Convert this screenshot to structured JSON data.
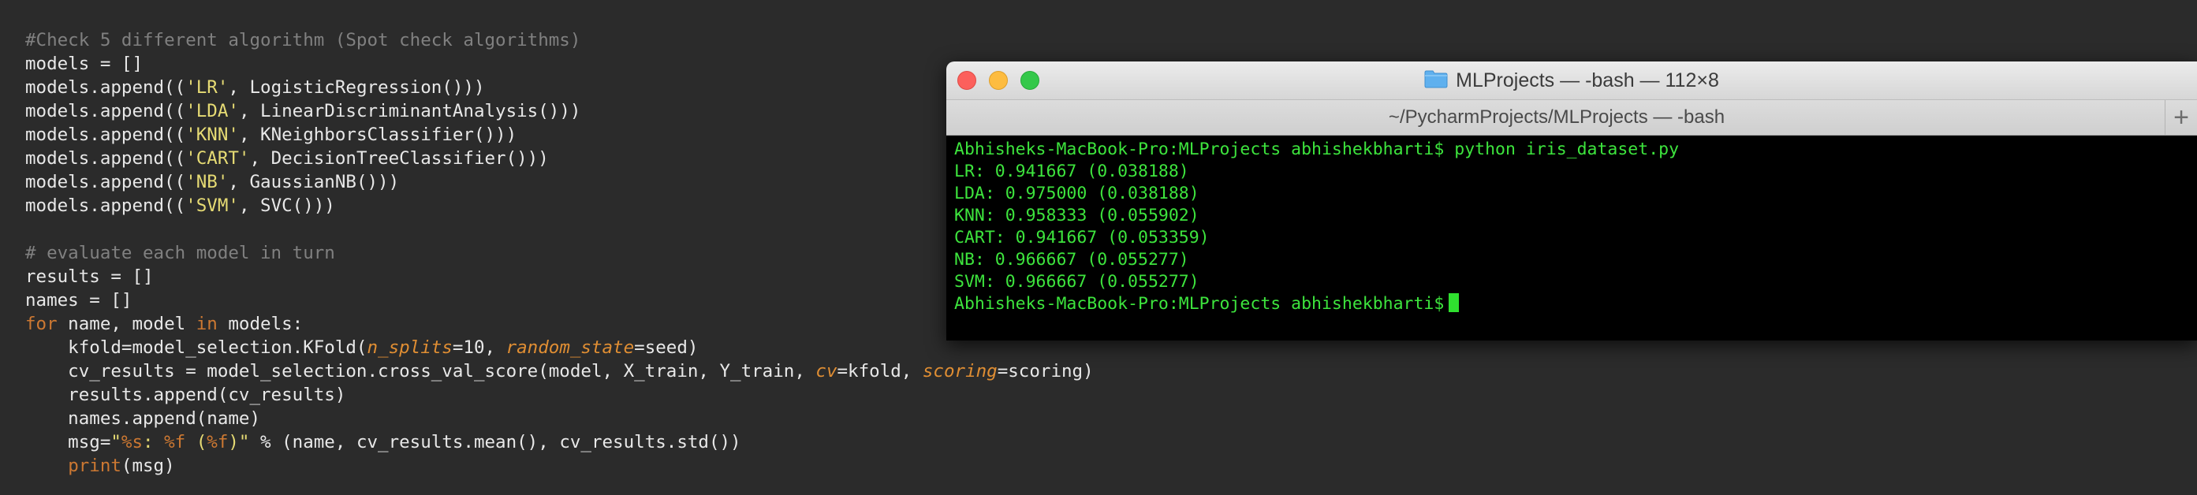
{
  "editor": {
    "lines": [
      [
        {
          "t": "#Check 5 different algorithm (Spot check algorithms)",
          "c": "cm"
        }
      ],
      [
        {
          "t": "models = []",
          "c": "n"
        }
      ],
      [
        {
          "t": "models.append((",
          "c": "n"
        },
        {
          "t": "'LR'",
          "c": "st"
        },
        {
          "t": ", LogisticRegression()))",
          "c": "n"
        }
      ],
      [
        {
          "t": "models.append((",
          "c": "n"
        },
        {
          "t": "'LDA'",
          "c": "st"
        },
        {
          "t": ", LinearDiscriminantAnalysis()))",
          "c": "n"
        }
      ],
      [
        {
          "t": "models.append((",
          "c": "n"
        },
        {
          "t": "'KNN'",
          "c": "st"
        },
        {
          "t": ", KNeighborsClassifier()))",
          "c": "n"
        }
      ],
      [
        {
          "t": "models.append((",
          "c": "n"
        },
        {
          "t": "'CART'",
          "c": "st"
        },
        {
          "t": ", DecisionTreeClassifier()))",
          "c": "n"
        }
      ],
      [
        {
          "t": "models.append((",
          "c": "n"
        },
        {
          "t": "'NB'",
          "c": "st"
        },
        {
          "t": ", GaussianNB()))",
          "c": "n"
        }
      ],
      [
        {
          "t": "models.append((",
          "c": "n"
        },
        {
          "t": "'SVM'",
          "c": "st"
        },
        {
          "t": ", SVC()))",
          "c": "n"
        }
      ],
      [],
      [
        {
          "t": "# evaluate each model in turn",
          "c": "cm"
        }
      ],
      [
        {
          "t": "results = []",
          "c": "n"
        }
      ],
      [
        {
          "t": "names = []",
          "c": "n"
        }
      ],
      [
        {
          "t": "for",
          "c": "kw"
        },
        {
          "t": " name, model ",
          "c": "n"
        },
        {
          "t": "in",
          "c": "kw"
        },
        {
          "t": " models:",
          "c": "n"
        }
      ],
      [
        {
          "t": "    kfold=model_selection.KFold(",
          "c": "n"
        },
        {
          "t": "n_splits",
          "c": "kwarg"
        },
        {
          "t": "=10, ",
          "c": "n"
        },
        {
          "t": "random_state",
          "c": "kwarg"
        },
        {
          "t": "=seed)",
          "c": "n"
        }
      ],
      [
        {
          "t": "    cv_results = model_selection.cross_val_score(model, X_train, Y_train, ",
          "c": "n"
        },
        {
          "t": "cv",
          "c": "kwarg"
        },
        {
          "t": "=kfold, ",
          "c": "n"
        },
        {
          "t": "scoring",
          "c": "kwarg"
        },
        {
          "t": "=scoring)",
          "c": "n"
        }
      ],
      [
        {
          "t": "    results.append(cv_results)",
          "c": "n"
        }
      ],
      [
        {
          "t": "    names.append(name)",
          "c": "n"
        }
      ],
      [
        {
          "t": "    msg=",
          "c": "n"
        },
        {
          "t": "\"",
          "c": "st"
        },
        {
          "t": "%s",
          "c": "fmt"
        },
        {
          "t": ": ",
          "c": "st"
        },
        {
          "t": "%f",
          "c": "fmt"
        },
        {
          "t": " (",
          "c": "st"
        },
        {
          "t": "%f",
          "c": "fmt"
        },
        {
          "t": ")\"",
          "c": "st"
        },
        {
          "t": " % (name, cv_results.mean(), cv_results.std())",
          "c": "n"
        }
      ],
      [
        {
          "t": "    ",
          "c": "n"
        },
        {
          "t": "print",
          "c": "kw"
        },
        {
          "t": "(msg)",
          "c": "n"
        }
      ]
    ]
  },
  "terminal": {
    "window_title": "MLProjects — -bash — 112×8",
    "tab_title": "~/PycharmProjects/MLProjects — -bash",
    "new_tab_label": "+",
    "lines": [
      "Abhisheks-MacBook-Pro:MLProjects abhishekbharti$ python iris_dataset.py",
      "LR: 0.941667 (0.038188)",
      "LDA: 0.975000 (0.038188)",
      "KNN: 0.958333 (0.055902)",
      "CART: 0.941667 (0.053359)",
      "NB: 0.966667 (0.055277)",
      "SVM: 0.966667 (0.055277)"
    ],
    "prompt": "Abhisheks-MacBook-Pro:MLProjects abhishekbharti$"
  },
  "icons": {
    "folder": "folder-icon",
    "close": "close-window-icon",
    "minimize": "minimize-window-icon",
    "maximize": "maximize-window-icon"
  },
  "colors": {
    "editor_bg": "#2b2b2b",
    "terminal_fg": "#3de43d",
    "string": "#e6db74",
    "keyword": "#cc7832",
    "comment": "#808080"
  }
}
